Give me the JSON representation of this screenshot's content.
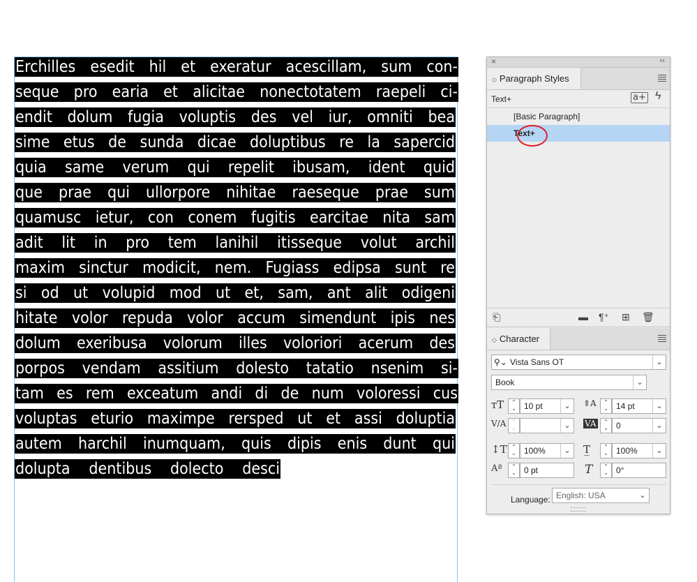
{
  "text_frame": {
    "lines": [
      "Erchilles esedit hil et exeratur acescillam, sum con-",
      "seque pro earia et alicitae nonectotatem raepeli ci-",
      "endit dolum fugia voluptis des vel iur, omniti bea",
      "sime etus de sunda dicae doluptibus re la sapercid",
      "quia same verum qui repelit ibusam, ident quid",
      "que prae qui ullorpore nihitae raeseque prae sum",
      "quamusc ietur, con conem fugitis earcitae nita sam",
      "adit lit in pro tem lanihil itisseque volut archil",
      "maxim sinctur modicit, nem. Fugiass edipsa sunt re",
      "si od ut volupid mod ut et, sam, ant alit odigeni",
      "hitate volor repuda volor accum simendunt ipis nes",
      "dolum exeribusa volorum illes voloriori acerum des",
      "porpos vendam assitium dolesto tatatio nsenim si-",
      "tam es rem exceatum andi di de num voloressi cus",
      "voluptas eturio maximpe rersped ut et assi doluptia",
      "autem harchil inumquam, quis dipis enis dunt qui",
      "dolupta dentibus dolecto desci"
    ]
  },
  "paragraph_panel": {
    "close_icon": "×",
    "collapse_icon": "‹‹",
    "tab_label": "Paragraph Styles",
    "current_style": "Text+",
    "styles": [
      "[Basic Paragraph]",
      "Text+"
    ],
    "selected_style": "Text+",
    "new_group_icon": "a+"
  },
  "character_panel": {
    "tab_label": "Character",
    "font_family": "Vista Sans OT",
    "font_style": "Book",
    "font_size": "10 pt",
    "leading": "14 pt",
    "kerning": "",
    "tracking": "0",
    "vertical_scale": "100%",
    "horizontal_scale": "100%",
    "baseline_shift": "0 pt",
    "skew": "0°",
    "language_label": "Language:",
    "language": "English: USA"
  },
  "colors": {
    "selection_blue": "#b6d5f4",
    "highlight_circle": "#e0202a",
    "text_highlight": "#000000",
    "frame_guide": "#7fc4e6"
  }
}
